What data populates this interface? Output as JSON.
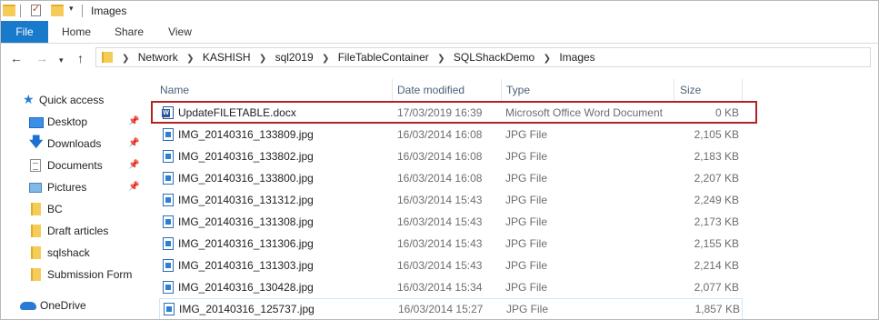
{
  "window": {
    "title": "Images"
  },
  "ribbon": {
    "tabs": [
      "File",
      "Home",
      "Share",
      "View"
    ]
  },
  "address": {
    "breadcrumbs": [
      "Network",
      "KASHISH",
      "sql2019",
      "FileTableContainer",
      "SQLShackDemo",
      "Images"
    ]
  },
  "nav": {
    "items": [
      {
        "label": "Quick access",
        "icon": "star-icon",
        "pinned": false
      },
      {
        "label": "Desktop",
        "icon": "desktop-icon",
        "pinned": true
      },
      {
        "label": "Downloads",
        "icon": "download-icon",
        "pinned": true
      },
      {
        "label": "Documents",
        "icon": "documents-icon",
        "pinned": true
      },
      {
        "label": "Pictures",
        "icon": "pictures-icon",
        "pinned": true
      },
      {
        "label": "BC",
        "icon": "folder-icon",
        "pinned": false
      },
      {
        "label": "Draft articles",
        "icon": "folder-icon",
        "pinned": false
      },
      {
        "label": "sqlshack",
        "icon": "folder-icon",
        "pinned": false
      },
      {
        "label": "Submission Form",
        "icon": "folder-icon",
        "pinned": false
      },
      {
        "label": "OneDrive",
        "icon": "onedrive-icon",
        "pinned": false
      }
    ]
  },
  "columns": {
    "name": "Name",
    "date": "Date modified",
    "type": "Type",
    "size": "Size"
  },
  "files": [
    {
      "name": "UpdateFILETABLE.docx",
      "date": "17/03/2019 16:39",
      "type": "Microsoft Office Word Document",
      "size": "0 KB",
      "icon": "word-document-icon"
    },
    {
      "name": "IMG_20140316_133809.jpg",
      "date": "16/03/2014 16:08",
      "type": "JPG File",
      "size": "2,105 KB",
      "icon": "jpg-file-icon"
    },
    {
      "name": "IMG_20140316_133802.jpg",
      "date": "16/03/2014 16:08",
      "type": "JPG File",
      "size": "2,183 KB",
      "icon": "jpg-file-icon"
    },
    {
      "name": "IMG_20140316_133800.jpg",
      "date": "16/03/2014 16:08",
      "type": "JPG File",
      "size": "2,207 KB",
      "icon": "jpg-file-icon"
    },
    {
      "name": "IMG_20140316_131312.jpg",
      "date": "16/03/2014 15:43",
      "type": "JPG File",
      "size": "2,249 KB",
      "icon": "jpg-file-icon"
    },
    {
      "name": "IMG_20140316_131308.jpg",
      "date": "16/03/2014 15:43",
      "type": "JPG File",
      "size": "2,173 KB",
      "icon": "jpg-file-icon"
    },
    {
      "name": "IMG_20140316_131306.jpg",
      "date": "16/03/2014 15:43",
      "type": "JPG File",
      "size": "2,155 KB",
      "icon": "jpg-file-icon"
    },
    {
      "name": "IMG_20140316_131303.jpg",
      "date": "16/03/2014 15:43",
      "type": "JPG File",
      "size": "2,214 KB",
      "icon": "jpg-file-icon"
    },
    {
      "name": "IMG_20140316_130428.jpg",
      "date": "16/03/2014 15:34",
      "type": "JPG File",
      "size": "2,077 KB",
      "icon": "jpg-file-icon"
    },
    {
      "name": "IMG_20140316_125737.jpg",
      "date": "16/03/2014 15:27",
      "type": "JPG File",
      "size": "1,857 KB",
      "icon": "jpg-file-icon"
    }
  ],
  "colors": {
    "file_tab": "#1979ca",
    "highlight_box": "#b22424"
  }
}
